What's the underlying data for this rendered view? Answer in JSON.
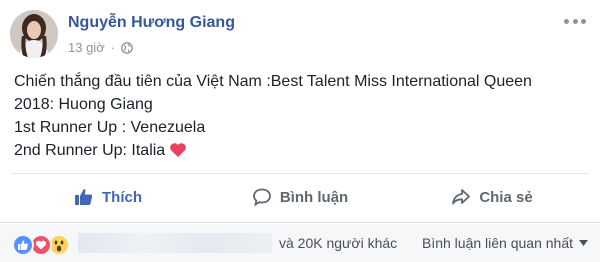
{
  "post": {
    "author": "Nguyễn Hương Giang",
    "time": "13 giờ",
    "separator": "·",
    "text_lines": [
      "Chiến thắng đầu tiên của Việt Nam :Best Talent Miss International Queen",
      "2018: Huong Giang",
      "1st Runner Up : Venezuela",
      "2nd Runner Up: Italia"
    ]
  },
  "actions": {
    "like": "Thích",
    "comment": "Bình luận",
    "share": "Chia sẻ"
  },
  "footer": {
    "others_count": "và 20K người khác",
    "comment_filter": "Bình luận liên quan nhất"
  },
  "icons": {
    "audience": "globe-icon",
    "options": "more-options-icon",
    "emoji": "heart-emoji-icon",
    "reactions": [
      "like-reaction-icon",
      "love-reaction-icon",
      "wow-reaction-icon"
    ]
  },
  "colors": {
    "author": "#365899",
    "like_active": "#4267b2",
    "heart": "#e8425f",
    "muted": "#90949c"
  }
}
